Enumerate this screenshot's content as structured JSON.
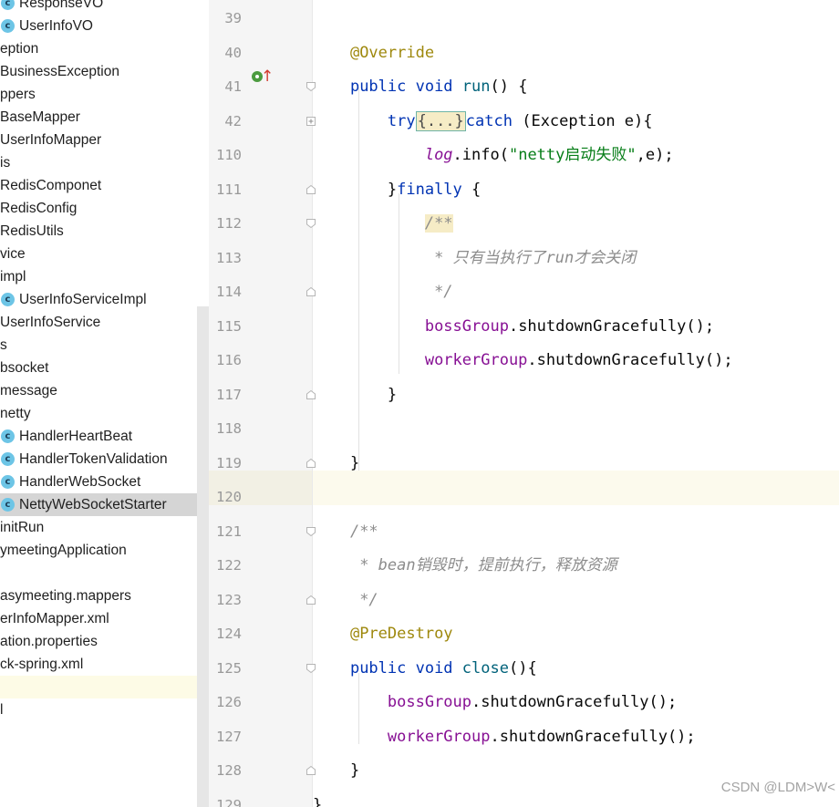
{
  "project_tree": {
    "items": [
      {
        "label": "ResponseVO",
        "is_class": true
      },
      {
        "label": "UserInfoVO",
        "is_class": true
      },
      {
        "label": "eption",
        "is_class": false
      },
      {
        "label": "BusinessException",
        "is_class": false
      },
      {
        "label": "ppers",
        "is_class": false
      },
      {
        "label": "BaseMapper",
        "is_class": false
      },
      {
        "label": "UserInfoMapper",
        "is_class": false
      },
      {
        "label": "is",
        "is_class": false
      },
      {
        "label": "RedisComponet",
        "is_class": false
      },
      {
        "label": "RedisConfig",
        "is_class": false
      },
      {
        "label": "RedisUtils",
        "is_class": false
      },
      {
        "label": "vice",
        "is_class": false
      },
      {
        "label": "impl",
        "is_class": false
      },
      {
        "label": "UserInfoServiceImpl",
        "is_class": true
      },
      {
        "label": "UserInfoService",
        "is_class": false
      },
      {
        "label": "s",
        "is_class": false
      },
      {
        "label": "bsocket",
        "is_class": false
      },
      {
        "label": "message",
        "is_class": false
      },
      {
        "label": "netty",
        "is_class": false
      },
      {
        "label": "HandlerHeartBeat",
        "is_class": true
      },
      {
        "label": "HandlerTokenValidation",
        "is_class": true
      },
      {
        "label": "HandlerWebSocket",
        "is_class": true
      },
      {
        "label": "NettyWebSocketStarter",
        "is_class": true,
        "selected": true
      },
      {
        "label": "initRun",
        "is_class": false
      },
      {
        "label": "ymeetingApplication",
        "is_class": false
      },
      {
        "label": "",
        "is_class": false
      },
      {
        "label": "asymeeting.mappers",
        "is_class": false
      },
      {
        "label": "erInfoMapper.xml",
        "is_class": false
      },
      {
        "label": "ation.properties",
        "is_class": false
      },
      {
        "label": "ck-spring.xml",
        "is_class": false
      },
      {
        "label": "",
        "is_class": false,
        "highlighted": true
      },
      {
        "label": "l",
        "is_class": false
      }
    ],
    "class_icon_letter": "c"
  },
  "editor": {
    "lines": [
      {
        "n": "39",
        "html": ""
      },
      {
        "n": "40",
        "html": "    <span class=\"an\">@Override</span>"
      },
      {
        "n": "41",
        "html": "    <span class=\"kw\">public void</span> <span class=\"fn\">run</span>() {"
      },
      {
        "n": "42",
        "html": "        <span class=\"kw\">try</span><span class=\"fold-inline\">{...}</span><span class=\"kw\">catch</span> (Exception e){"
      },
      {
        "n": "110",
        "html": "            <span class=\"logf\">log</span>.info(<span class=\"str\">\"netty启动失败\"</span>,e);"
      },
      {
        "n": "111",
        "html": "        }<span class=\"kw\">finally</span> {"
      },
      {
        "n": "112",
        "html": "            <span class=\"cm doc-hl\">/**</span>"
      },
      {
        "n": "113",
        "html": "             <span class=\"cm\">* 只有当执行了run才会关闭</span>"
      },
      {
        "n": "114",
        "html": "             <span class=\"cm\">*/</span>"
      },
      {
        "n": "115",
        "html": "            <span class=\"fld\">bossGroup</span>.shutdownGracefully();"
      },
      {
        "n": "116",
        "html": "            <span class=\"fld\">workerGroup</span>.shutdownGracefully();"
      },
      {
        "n": "117",
        "html": "        }"
      },
      {
        "n": "118",
        "html": ""
      },
      {
        "n": "119",
        "html": "    }"
      },
      {
        "n": "120",
        "html": ""
      },
      {
        "n": "121",
        "html": "    <span class=\"cm\">/**</span>"
      },
      {
        "n": "122",
        "html": "     <span class=\"cm\">* bean销毁时，提前执行，释放资源</span>"
      },
      {
        "n": "123",
        "html": "     <span class=\"cm\">*/</span>"
      },
      {
        "n": "124",
        "html": "    <span class=\"an\">@PreDestroy</span>"
      },
      {
        "n": "125",
        "html": "    <span class=\"kw\">public void</span> <span class=\"fn\">close</span>(){"
      },
      {
        "n": "126",
        "html": "        <span class=\"fld\">bossGroup</span>.shutdownGracefully();"
      },
      {
        "n": "127",
        "html": "        <span class=\"fld\">workerGroup</span>.shutdownGracefully();"
      },
      {
        "n": "128",
        "html": "    }"
      },
      {
        "n": "129",
        "html": "}"
      }
    ],
    "current_line": "120"
  },
  "watermark": "CSDN @LDM>W<",
  "colors": {
    "keyword": "#0033b3",
    "annotation": "#9e880d",
    "method": "#00627a",
    "field": "#871094",
    "string": "#067d17",
    "comment": "#8c8c8c",
    "class_icon": "#6dc5e6",
    "override_icon": "#4b9b3f",
    "up_arrow": "#d23b2f"
  }
}
